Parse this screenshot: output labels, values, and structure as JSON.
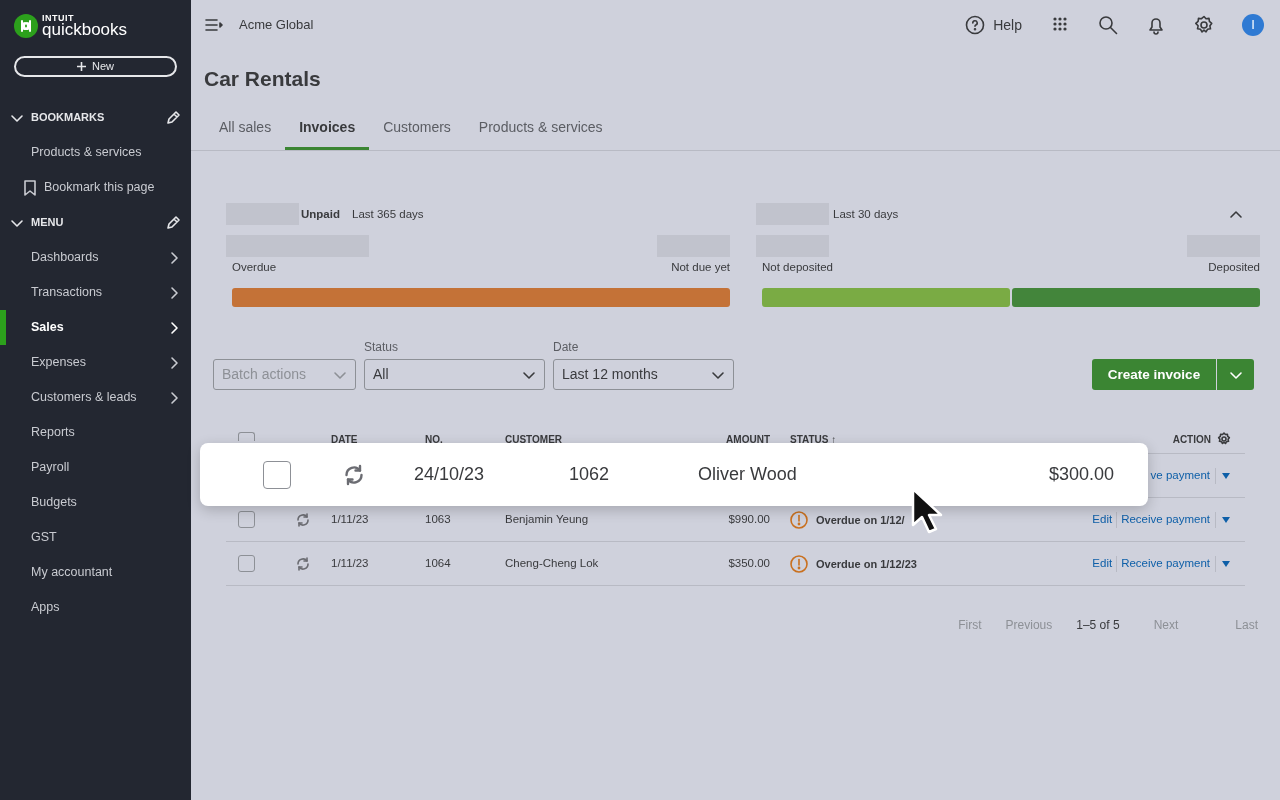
{
  "sidebar": {
    "logo": {
      "brand_small": "INTUIT",
      "brand": "quickbooks"
    },
    "new_button": "New",
    "sections": [
      {
        "title": "BOOKMARKS",
        "expanded": true,
        "items": [
          {
            "label": "Products & services",
            "kind": "link",
            "has_submenu": false,
            "selected": false
          },
          {
            "label": "Bookmark this page",
            "kind": "bookmark",
            "has_submenu": false,
            "selected": false
          }
        ]
      },
      {
        "title": "MENU",
        "expanded": true,
        "items": [
          {
            "label": "Dashboards",
            "kind": "link",
            "has_submenu": true,
            "selected": false
          },
          {
            "label": "Transactions",
            "kind": "link",
            "has_submenu": true,
            "selected": false
          },
          {
            "label": "Sales",
            "kind": "link",
            "has_submenu": true,
            "selected": true
          },
          {
            "label": "Expenses",
            "kind": "link",
            "has_submenu": true,
            "selected": false
          },
          {
            "label": "Customers & leads",
            "kind": "link",
            "has_submenu": true,
            "selected": false
          },
          {
            "label": "Reports",
            "kind": "link",
            "has_submenu": false,
            "selected": false
          },
          {
            "label": "Payroll",
            "kind": "link",
            "has_submenu": false,
            "selected": false
          },
          {
            "label": "Budgets",
            "kind": "link",
            "has_submenu": false,
            "selected": false
          },
          {
            "label": "GST",
            "kind": "link",
            "has_submenu": false,
            "selected": false
          },
          {
            "label": "My accountant",
            "kind": "link",
            "has_submenu": false,
            "selected": false
          },
          {
            "label": "Apps",
            "kind": "link",
            "has_submenu": false,
            "selected": false
          }
        ]
      }
    ]
  },
  "topbar": {
    "company": "Acme Global",
    "help": "Help",
    "avatar": "I"
  },
  "page_title": "Car Rentals",
  "tabs": [
    {
      "label": "All sales",
      "selected": false
    },
    {
      "label": "Invoices",
      "selected": true
    },
    {
      "label": "Customers",
      "selected": false
    },
    {
      "label": "Products & services",
      "selected": false
    }
  ],
  "summary": [
    {
      "label": "Unpaid",
      "period": "Last 365 days",
      "left": "Overdue",
      "right": "Not due yet",
      "bars": [
        {
          "color": "#c47237"
        }
      ]
    },
    {
      "period": "Last 30 days",
      "left": "Not deposited",
      "right": "Deposited",
      "bars": [
        {
          "color": "#7aab44"
        },
        {
          "color": "#43853b"
        }
      ]
    }
  ],
  "filters": {
    "batch": "Batch actions",
    "status": {
      "label": "Status",
      "value": "All"
    },
    "date": {
      "label": "Date",
      "value": "Last 12 months"
    }
  },
  "create_button": "Create invoice",
  "table": {
    "select_all_checked": false,
    "columns": [
      "DATE",
      "NO.",
      "CUSTOMER",
      "AMOUNT",
      "STATUS ↑",
      "ACTION"
    ],
    "hidden_row_fragment": "ve payment",
    "rows": [
      {
        "checked": false,
        "date": "1/11/23",
        "no": "1063",
        "customer": "Benjamin Yeung",
        "amount": "$990.00",
        "status": "Overdue on 1/12/",
        "edit": "Edit",
        "receive": "Receive payment"
      },
      {
        "checked": false,
        "date": "1/11/23",
        "no": "1064",
        "customer": "Cheng-Cheng Lok",
        "amount": "$350.00",
        "status": "Overdue on 1/12/23",
        "edit": "Edit",
        "receive": "Receive payment"
      }
    ]
  },
  "highlighted_row": {
    "checked": false,
    "date": "24/10/23",
    "no": "1062",
    "customer": "Oliver Wood",
    "amount": "$300.00"
  },
  "pagination": {
    "buttons": [
      {
        "label": "First",
        "disabled": true
      },
      {
        "label": "Previous",
        "disabled": true
      },
      {
        "label": "Next",
        "disabled": true
      },
      {
        "label": "Last",
        "disabled": true
      }
    ],
    "range": "1–5 of 5"
  }
}
